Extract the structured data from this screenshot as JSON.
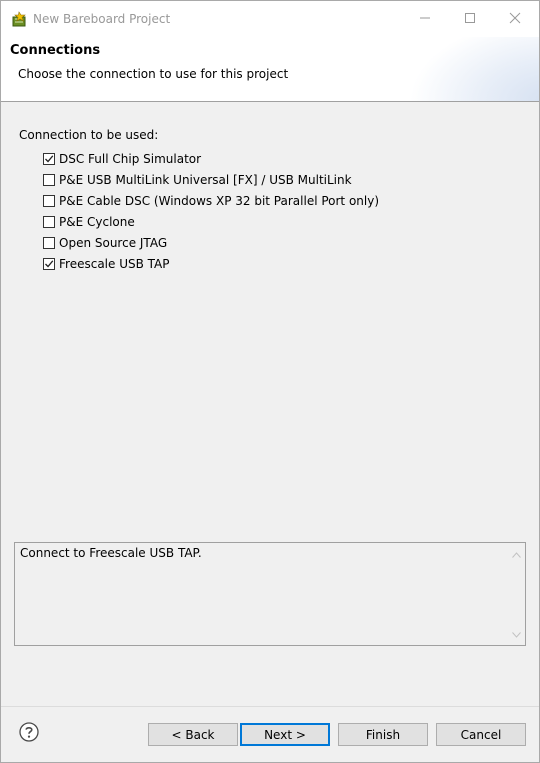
{
  "window": {
    "title": "New Bareboard Project",
    "controls": {
      "minimize": "minimize-icon",
      "maximize": "maximize-icon",
      "close": "close-icon"
    }
  },
  "banner": {
    "title": "Connections",
    "description": "Choose the connection to use for this project"
  },
  "connections": {
    "label": "Connection to be used:",
    "items": [
      {
        "label": "DSC Full Chip Simulator",
        "checked": true
      },
      {
        "label": "P&E USB MultiLink Universal [FX] / USB MultiLink",
        "checked": false
      },
      {
        "label": "P&E Cable DSC (Windows XP 32 bit Parallel Port only)",
        "checked": false
      },
      {
        "label": "P&E Cyclone",
        "checked": false
      },
      {
        "label": "Open Source JTAG",
        "checked": false
      },
      {
        "label": "Freescale USB TAP",
        "checked": true
      }
    ]
  },
  "details": {
    "text": "Connect to Freescale USB TAP."
  },
  "buttons": {
    "back": "< Back",
    "next": "Next >",
    "finish": "Finish",
    "cancel": "Cancel"
  },
  "colors": {
    "default_button_border": "#0078d7",
    "title_inactive": "#999999"
  }
}
